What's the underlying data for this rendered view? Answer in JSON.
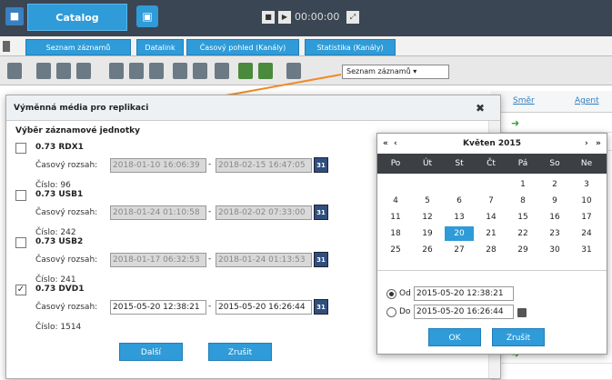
{
  "topbar": {
    "logo": "■",
    "catalog_label": "Catalog",
    "monitor_icon": "▣",
    "time": "00:00:00"
  },
  "tabs": [
    {
      "label": "Seznam záznamů"
    },
    {
      "label": "Datalink"
    },
    {
      "label": "Časový pohled (Kanály)"
    },
    {
      "label": "Statistika (Kanály)"
    }
  ],
  "toolbar": {
    "view_select": "Seznam záznamů"
  },
  "table": {
    "col_smer": "Směr",
    "col_agent": "Agent"
  },
  "dialog": {
    "title": "Výměnná média pro replikaci",
    "close": "✖",
    "section": "Výběr záznamové jednotky",
    "range_label": "Časový rozsah:",
    "units": [
      {
        "name": "0.73 RDX1",
        "checked": false,
        "from": "2018-01-10 16:06:39",
        "to": "2018-02-15 16:47:05",
        "count": "Číslo: 96",
        "disabled": true
      },
      {
        "name": "0.73 USB1",
        "checked": false,
        "from": "2018-01-24 01:10:58",
        "to": "2018-02-02 07:33:00",
        "count": "Číslo: 242",
        "disabled": true
      },
      {
        "name": "0.73 USB2",
        "checked": false,
        "from": "2018-01-17 06:32:53",
        "to": "2018-01-24 01:13:53",
        "count": "Číslo: 241",
        "disabled": true
      },
      {
        "name": "0.73 DVD1",
        "checked": true,
        "from": "2015-05-20 12:38:21",
        "to": "2015-05-20 16:26:44",
        "count": "Číslo: 1514",
        "disabled": false
      }
    ],
    "next": "Další",
    "cancel": "Zrušit"
  },
  "calendar": {
    "month": "Květen 2015",
    "days": [
      "Po",
      "Út",
      "St",
      "Čt",
      "Pá",
      "So",
      "Ne"
    ],
    "weeks": [
      [
        "",
        "",
        "",
        "",
        "1",
        "2",
        "3"
      ],
      [
        "4",
        "5",
        "6",
        "7",
        "8",
        "9",
        "10"
      ],
      [
        "11",
        "12",
        "13",
        "14",
        "15",
        "16",
        "17"
      ],
      [
        "18",
        "19",
        "20",
        "21",
        "22",
        "23",
        "24"
      ],
      [
        "25",
        "26",
        "27",
        "28",
        "29",
        "30",
        "31"
      ]
    ],
    "selected": "20",
    "from_label": "Od",
    "to_label": "Do",
    "from": "2015-05-20 12:38:21",
    "to": "2015-05-20 16:26:44",
    "ok": "OK",
    "cancel": "Zrušit"
  }
}
